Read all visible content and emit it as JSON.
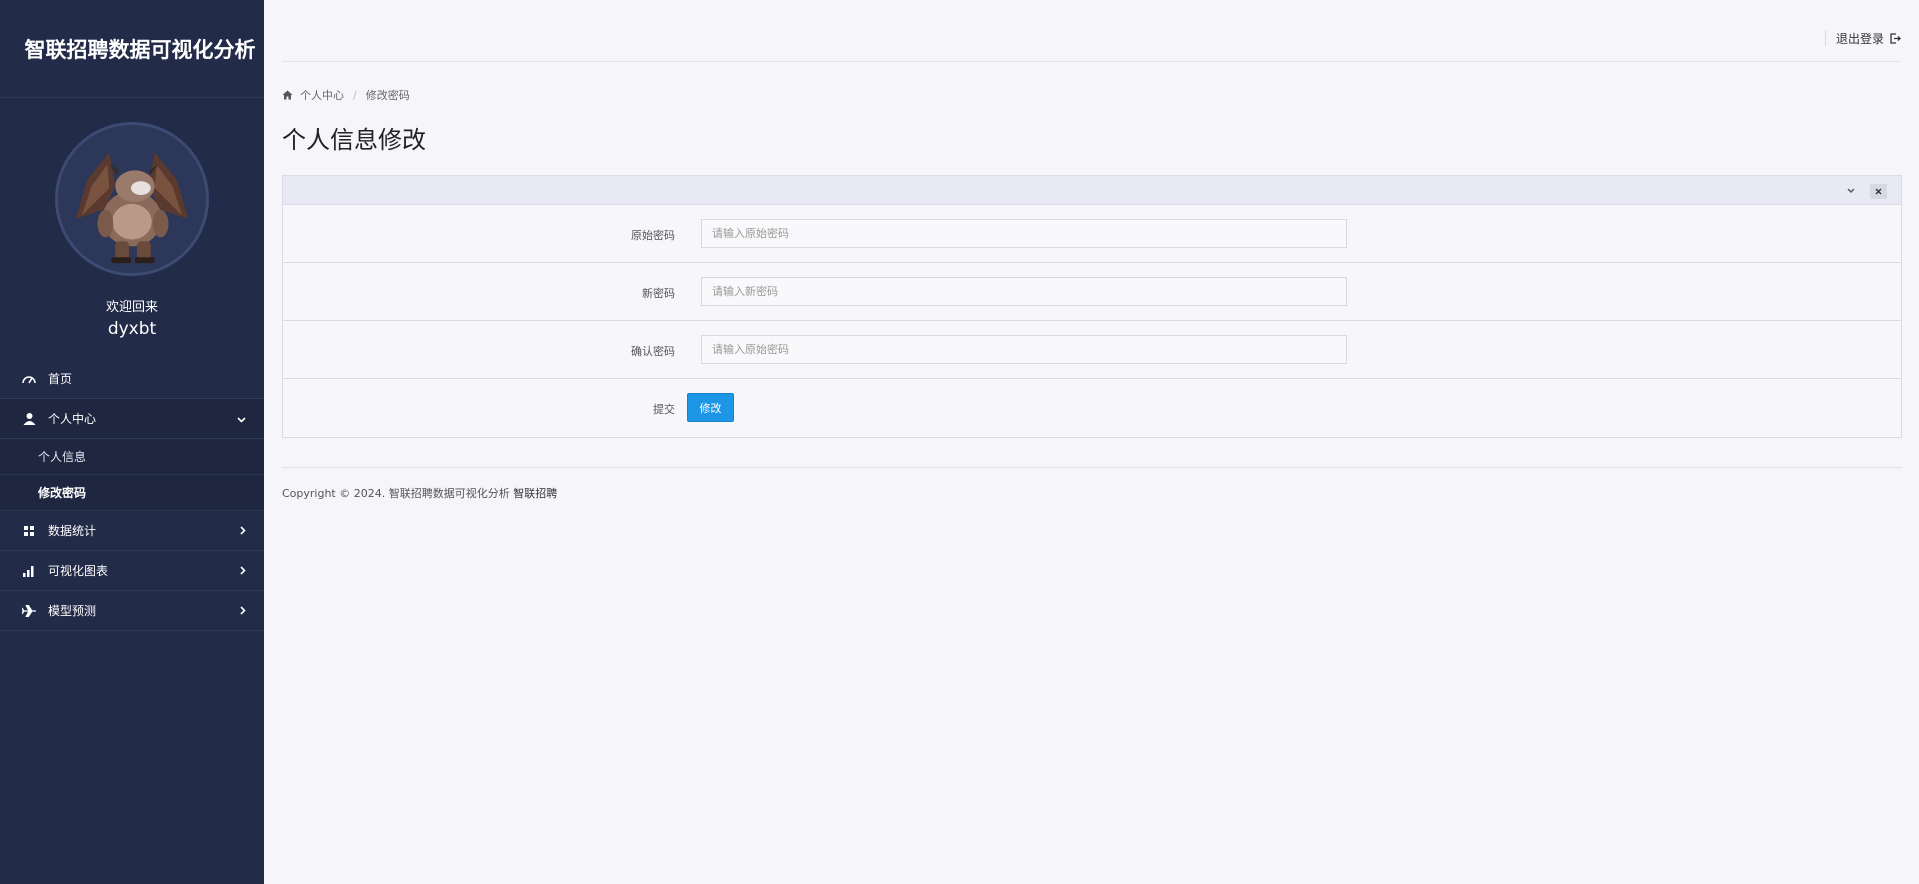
{
  "app": {
    "title": "智联招聘数据可视化分析"
  },
  "profile": {
    "welcome": "欢迎回来",
    "username": "dyxbt",
    "avatar_icon": "gargoyle-avatar"
  },
  "sidebar": {
    "items": [
      {
        "label": "首页",
        "icon": "dashboard-icon"
      },
      {
        "label": "个人中心",
        "icon": "user-icon",
        "expanded": true,
        "children": [
          {
            "label": "个人信息"
          },
          {
            "label": "修改密码",
            "active": true
          }
        ]
      },
      {
        "label": "数据统计",
        "icon": "grid-icon"
      },
      {
        "label": "可视化图表",
        "icon": "bar-chart-icon"
      },
      {
        "label": "模型预测",
        "icon": "plane-icon"
      }
    ]
  },
  "header": {
    "logout_label": "退出登录"
  },
  "breadcrumb": {
    "items": [
      "个人中心",
      "修改密码"
    ],
    "separator": "/"
  },
  "page": {
    "title": "个人信息修改"
  },
  "form": {
    "fields": [
      {
        "label": "原始密码",
        "placeholder": "请输入原始密码",
        "value": ""
      },
      {
        "label": "新密码",
        "placeholder": "请输入新密码",
        "value": ""
      },
      {
        "label": "确认密码",
        "placeholder": "请输入原始密码",
        "value": ""
      }
    ],
    "submit_label": "提交",
    "submit_button": "修改"
  },
  "footer": {
    "text": "Copyright © 2024. 智联招聘数据可视化分析",
    "brand": "智联招聘"
  },
  "colors": {
    "sidebar_bg": "#222b48",
    "page_bg": "#f6f6fa",
    "accent": "#1e96e6"
  }
}
